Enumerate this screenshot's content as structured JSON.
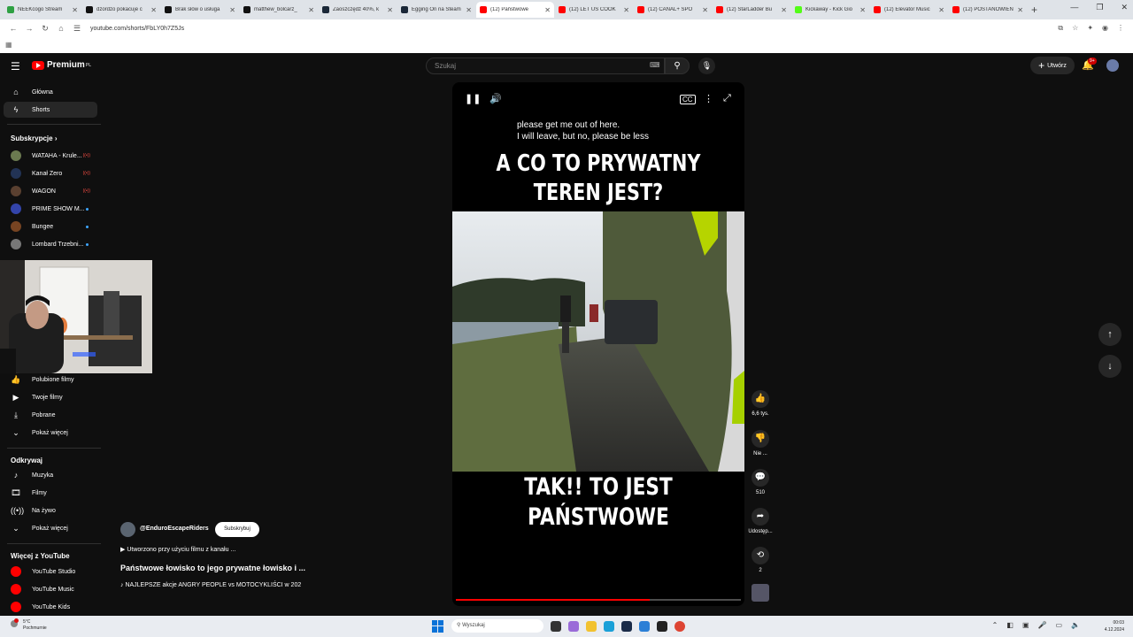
{
  "browser": {
    "tabs": [
      {
        "label": "NEEKcogo Stream",
        "color": "#2ea043"
      },
      {
        "label": "dzordzo pokacuje c",
        "color": "#111111"
      },
      {
        "label": "Brak słów o usługa",
        "color": "#111111"
      },
      {
        "label": "matthew_bolcarz_",
        "color": "#111111"
      },
      {
        "label": "Zaoszczędź 40%, k",
        "color": "#1b2838"
      },
      {
        "label": "Egging On na Steam",
        "color": "#1b2838"
      },
      {
        "label": "(12) Państwowe",
        "color": "#ff0000",
        "active": true
      },
      {
        "label": "(12) LET US COOK",
        "color": "#ff0000"
      },
      {
        "label": "(12) CANAL+ SPO",
        "color": "#ff0000"
      },
      {
        "label": "(12) StarLadder Bu",
        "color": "#ff0000"
      },
      {
        "label": "Kickaway - Kick Gio",
        "color": "#53fc18"
      },
      {
        "label": "(12) Elevator Music",
        "color": "#ff0000"
      },
      {
        "label": "(12) POSTANOWIEN",
        "color": "#ff0000"
      }
    ],
    "url": "youtube.com/shorts/FbLY0h7Z5Js",
    "window_controls": {
      "minimize": "—",
      "maximize": "❐",
      "close": "✕"
    }
  },
  "header": {
    "logo_text": "Premium",
    "logo_region": "PL",
    "search_placeholder": "Szukaj",
    "create_label": "Utwórz",
    "notification_count": "9+"
  },
  "sidebar": {
    "main": [
      {
        "label": "Główna",
        "icon": "home-icon"
      },
      {
        "label": "Shorts",
        "icon": "shorts-icon",
        "active": true
      }
    ],
    "subscriptions_title": "Subskrypcje",
    "subscriptions": [
      {
        "label": "WATAHA - Krule...",
        "indicator": "live",
        "color": "#6b7a50"
      },
      {
        "label": "Kanał Zero",
        "indicator": "live",
        "color": "#223355"
      },
      {
        "label": "WAGON",
        "indicator": "live",
        "color": "#5a4030"
      },
      {
        "label": "PRIME SHOW M...",
        "indicator": "dot",
        "color": "#3344aa"
      },
      {
        "label": "Bungee",
        "indicator": "dot",
        "color": "#774422"
      },
      {
        "label": "Lombard Trzebni...",
        "indicator": "dot",
        "color": "#777777"
      }
    ],
    "live_badge": "((•))",
    "you_items": [
      {
        "label": "Polubione filmy",
        "icon": "thumbs-up-icon"
      },
      {
        "label": "Twoje filmy",
        "icon": "video-icon"
      },
      {
        "label": "Pobrane",
        "icon": "download-icon"
      },
      {
        "label": "Pokaż więcej",
        "icon": "chevron-down-icon"
      }
    ],
    "explore_title": "Odkrywaj",
    "explore": [
      {
        "label": "Muzyka",
        "icon": "music-icon"
      },
      {
        "label": "Filmy",
        "icon": "film-icon"
      },
      {
        "label": "Na żywo",
        "icon": "live-icon"
      },
      {
        "label": "Pokaż więcej",
        "icon": "chevron-down-icon"
      }
    ],
    "more_title": "Więcej z YouTube",
    "more": [
      {
        "label": "YouTube Studio"
      },
      {
        "label": "YouTube Music"
      },
      {
        "label": "YouTube Kids"
      }
    ]
  },
  "video": {
    "subtitle_line1": "please get me out of here.",
    "subtitle_line2": "I will leave, but no, please be less",
    "caption_top": "A CO TO PRYWATNY TEREN JEST?",
    "caption_bottom": "TAK!! TO JEST PAŃSTWOWE",
    "progress": 0.68
  },
  "actions": {
    "likes": "6,6 tys.",
    "dislike": "Nie ...",
    "comments": "510",
    "share": "Udostęp...",
    "remix": "2"
  },
  "channel": {
    "handle": "@EnduroEscapeRiders",
    "subscribe_label": "Subskrybuj",
    "made_with": "▶ Utworzono przy użyciu filmu z kanału ...",
    "title": "Państwowe łowisko to jego prywatne łowisko i ...",
    "music": "♪ NAJLEPSZE akcje ANGRY PEOPLE vs MOTOCYKLIŚCI w 202"
  },
  "taskbar": {
    "temperature": "5°C",
    "weather": "Pochmurnie",
    "search_label": "Wyszukaj",
    "time": "00:03",
    "date": "4.12.2024"
  }
}
